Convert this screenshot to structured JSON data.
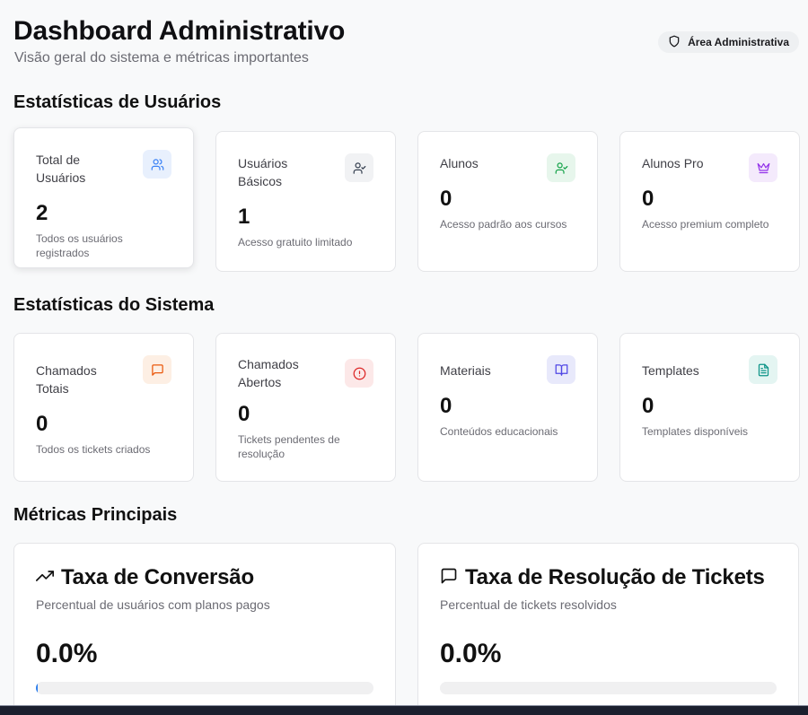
{
  "header": {
    "title": "Dashboard Administrativo",
    "subtitle": "Visão geral do sistema e métricas importantes",
    "badge": {
      "label": "Área Administrativa",
      "icon": "shield-icon"
    }
  },
  "user_stats": {
    "title": "Estatísticas de Usuários",
    "cards": [
      {
        "label": "Total de Usuários",
        "value": "2",
        "desc": "Todos os usuários registrados",
        "icon": "users-icon",
        "color": "#3b82f6",
        "bg": "#e8f0fd"
      },
      {
        "label": "Usuários Básicos",
        "value": "1",
        "desc": "Acesso gratuito limitado",
        "icon": "user-check-icon",
        "color": "#374151",
        "bg": "#f1f2f4"
      },
      {
        "label": "Alunos",
        "value": "0",
        "desc": "Acesso padrão aos cursos",
        "icon": "user-check-icon",
        "color": "#16a34a",
        "bg": "#e7f6ec"
      },
      {
        "label": "Alunos Pro",
        "value": "0",
        "desc": "Acesso premium completo",
        "icon": "crown-icon",
        "color": "#9333ea",
        "bg": "#f4eafc"
      }
    ]
  },
  "system_stats": {
    "title": "Estatísticas do Sistema",
    "cards": [
      {
        "label": "Chamados Totais",
        "value": "0",
        "desc": "Todos os tickets criados",
        "icon": "message-square-icon",
        "color": "#ea580c",
        "bg": "#fdefe4"
      },
      {
        "label": "Chamados Abertos",
        "value": "0",
        "desc": "Tickets pendentes de resolução",
        "icon": "alert-circle-icon",
        "color": "#dc2626",
        "bg": "#fce8e8"
      },
      {
        "label": "Materiais",
        "value": "0",
        "desc": "Conteúdos educacionais",
        "icon": "book-open-icon",
        "color": "#4f46e5",
        "bg": "#e8e9fb"
      },
      {
        "label": "Templates",
        "value": "0",
        "desc": "Templates disponíveis",
        "icon": "file-text-icon",
        "color": "#0d9488",
        "bg": "#e4f5f2"
      }
    ]
  },
  "metrics": {
    "title": "Métricas Principais",
    "cards": [
      {
        "title": "Taxa de Conversão",
        "desc": "Percentual de usuários com planos pagos",
        "value": "0.0%",
        "progress": 0.0,
        "icon": "trending-up-icon"
      },
      {
        "title": "Taxa de Resolução de Tickets",
        "desc": "Percentual de tickets resolvidos",
        "value": "0.0%",
        "progress": 0.0,
        "icon": "message-square-icon"
      }
    ]
  }
}
